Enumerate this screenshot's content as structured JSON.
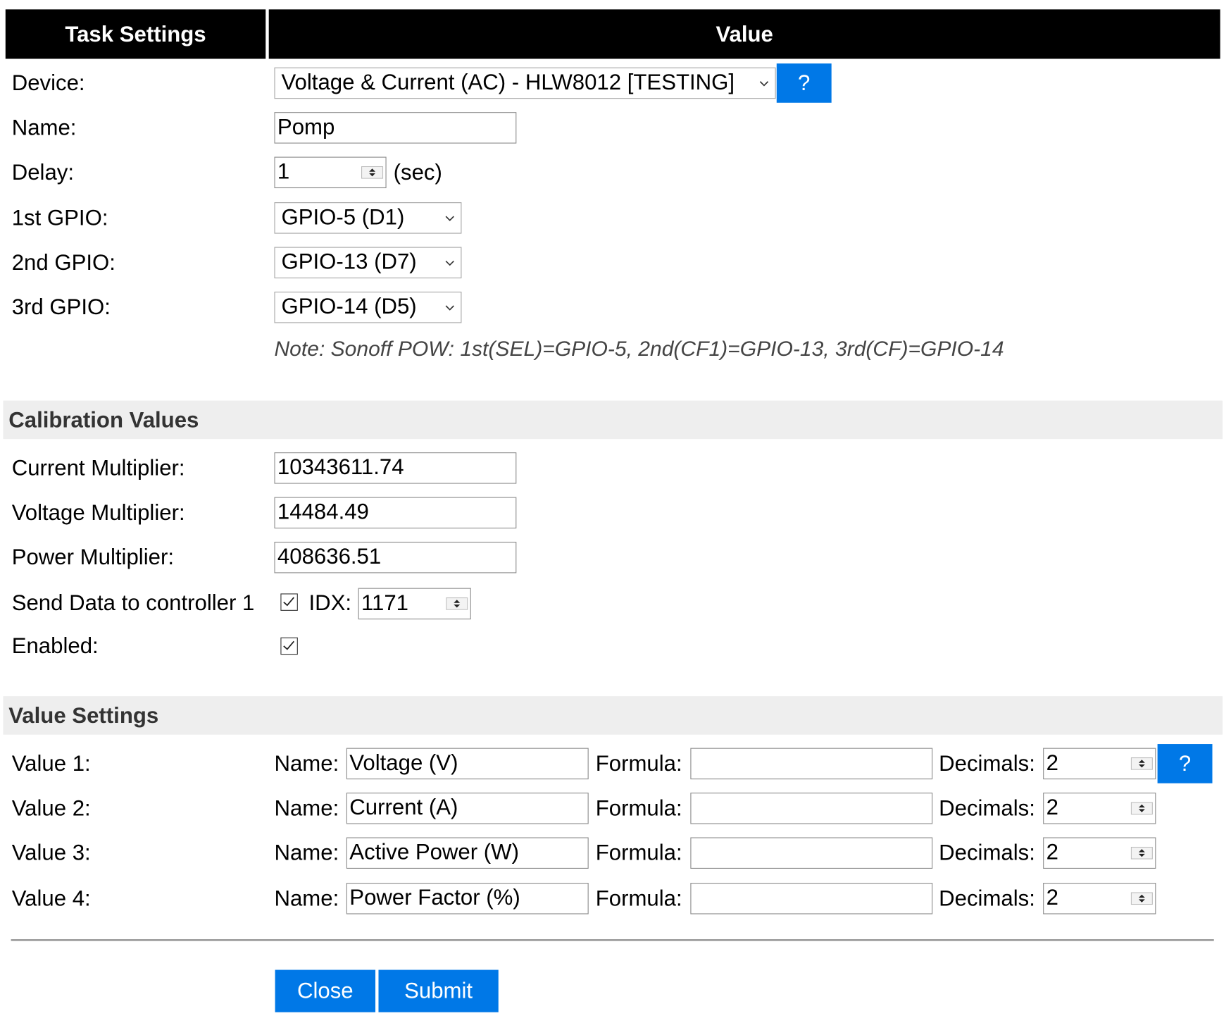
{
  "header": {
    "col1": "Task Settings",
    "col2": "Value"
  },
  "device": {
    "label": "Device:",
    "value": "Voltage & Current (AC) - HLW8012 [TESTING]",
    "help": "?"
  },
  "name": {
    "label": "Name:",
    "value": "Pomp"
  },
  "delay": {
    "label": "Delay:",
    "value": "1",
    "unit": "(sec)"
  },
  "gpio1": {
    "label": "1st GPIO:",
    "value": "GPIO-5 (D1)"
  },
  "gpio2": {
    "label": "2nd GPIO:",
    "value": "GPIO-13 (D7)"
  },
  "gpio3": {
    "label": "3rd GPIO:",
    "value": "GPIO-14 (D5)"
  },
  "note": "Note: Sonoff POW: 1st(SEL)=GPIO-5, 2nd(CF1)=GPIO-13, 3rd(CF)=GPIO-14",
  "calibration": {
    "title": "Calibration Values",
    "current": {
      "label": "Current Multiplier:",
      "value": "10343611.74"
    },
    "voltage": {
      "label": "Voltage Multiplier:",
      "value": "14484.49"
    },
    "power": {
      "label": "Power Multiplier:",
      "value": "408636.51"
    }
  },
  "send": {
    "label": "Send Data to controller 1",
    "checked": true,
    "idx_label": "IDX:",
    "idx_value": "1171"
  },
  "enabled": {
    "label": "Enabled:",
    "checked": true
  },
  "value_settings": {
    "title": "Value Settings",
    "name_label": "Name:",
    "formula_label": "Formula:",
    "decimals_label": "Decimals:",
    "help": "?",
    "rows": [
      {
        "label": "Value 1:",
        "name": "Voltage (V)",
        "formula": "",
        "decimals": "2"
      },
      {
        "label": "Value 2:",
        "name": "Current (A)",
        "formula": "",
        "decimals": "2"
      },
      {
        "label": "Value 3:",
        "name": "Active Power (W)",
        "formula": "",
        "decimals": "2"
      },
      {
        "label": "Value 4:",
        "name": "Power Factor (%)",
        "formula": "",
        "decimals": "2"
      }
    ]
  },
  "buttons": {
    "close": "Close",
    "submit": "Submit"
  }
}
